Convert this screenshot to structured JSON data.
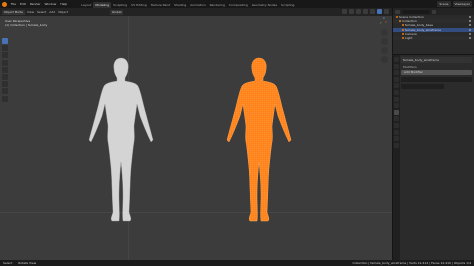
{
  "app": {
    "menu": [
      "File",
      "Edit",
      "Render",
      "Window",
      "Help"
    ],
    "workspaces": [
      "Layout",
      "Modeling",
      "Sculpting",
      "UV Editing",
      "Texture Paint",
      "Shading",
      "Animation",
      "Rendering",
      "Compositing",
      "Geometry Nodes",
      "Scripting"
    ],
    "active_workspace": "Modeling",
    "scene": "Scene",
    "view_layer": "ViewLayer"
  },
  "viewport": {
    "mode": "Object Mode",
    "menus": [
      "View",
      "Select",
      "Add",
      "Object"
    ],
    "transform": "Global",
    "info_line1": "User Perspective",
    "info_line2": "(1) Collection | female_body",
    "axis_x": "X",
    "axis_y": "Y",
    "axis_z": "Z"
  },
  "outliner": {
    "rows": [
      {
        "label": "Scene Collection",
        "selected": false
      },
      {
        "label": "Collection",
        "selected": false
      },
      {
        "label": "female_body_base",
        "selected": false
      },
      {
        "label": "female_body_wireframe",
        "selected": true
      },
      {
        "label": "Camera",
        "selected": false
      },
      {
        "label": "Light",
        "selected": false
      }
    ]
  },
  "properties": {
    "section": "female_body_wireframe",
    "panel_title": "Modifiers",
    "add_modifier": "Add Modifier"
  },
  "status": {
    "left": "Select",
    "middle": "Rotate View",
    "right": "Collection | female_body_wireframe | Verts 12,412 | Faces 12,410 | Objects 1/4"
  },
  "colors": {
    "accent": "#e87d0d",
    "selected_mesh": "#ff7f14",
    "base_mesh": "#d4d4d4",
    "viewport_bg": "#3c3c3c"
  },
  "icons": {
    "logo": "blender-logo-icon",
    "tools": [
      "select-box-icon",
      "cursor-icon",
      "move-icon",
      "rotate-icon",
      "scale-icon",
      "transform-icon",
      "annotate-icon",
      "measure-icon",
      "add-cube-icon"
    ]
  }
}
